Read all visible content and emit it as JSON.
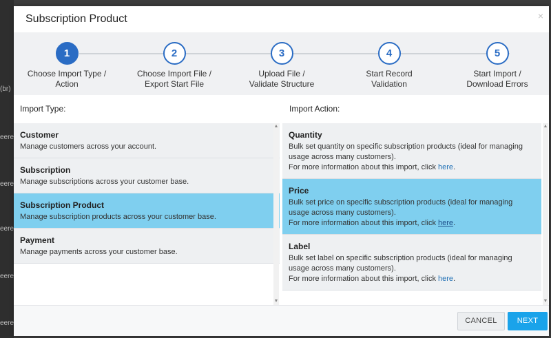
{
  "background": {
    "fragments": [
      "(br)",
      "eere",
      "eere",
      "eere",
      "eere",
      "eere",
      "eere"
    ]
  },
  "modal": {
    "title": "Subscription Product",
    "close_icon": "×"
  },
  "wizard": {
    "steps": [
      {
        "number": "1",
        "line1": "Choose Import Type /",
        "line2": "Action",
        "active": true
      },
      {
        "number": "2",
        "line1": "Choose Import File /",
        "line2": "Export Start File",
        "active": false
      },
      {
        "number": "3",
        "line1": "Upload File /",
        "line2": "Validate Structure",
        "active": false
      },
      {
        "number": "4",
        "line1": "Start Record",
        "line2": "Validation",
        "active": false
      },
      {
        "number": "5",
        "line1": "Start Import /",
        "line2": "Download Errors",
        "active": false
      }
    ]
  },
  "import_type": {
    "heading": "Import Type:",
    "items": [
      {
        "title": "Customer",
        "desc": "Manage customers across your account."
      },
      {
        "title": "Subscription",
        "desc": "Manage subscriptions across your customer base."
      },
      {
        "title": "Subscription Product",
        "desc": "Manage subscription products across your customer base.",
        "selected": true
      },
      {
        "title": "Payment",
        "desc": "Manage payments across your customer base."
      }
    ]
  },
  "import_action": {
    "heading": "Import Action:",
    "items": [
      {
        "title": "Quantity",
        "desc": "Bulk set quantity on specific subscription products (ideal for managing usage across many customers).",
        "more": "For more information about this import, click ",
        "link": "here",
        "tail": "."
      },
      {
        "title": "Price",
        "desc": "Bulk set price on specific subscription products (ideal for managing usage across many customers).",
        "more": "For more information about this import, click ",
        "link": "here",
        "tail": ".",
        "selected": true
      },
      {
        "title": "Label",
        "desc": "Bulk set label on specific subscription products (ideal for managing usage across many customers).",
        "more": "For more information about this import, click ",
        "link": "here",
        "tail": "."
      }
    ]
  },
  "footer": {
    "cancel_label": "CANCEL",
    "next_label": "NEXT"
  },
  "colors": {
    "accent": "#2a6cc4",
    "selected_row": "#7fcfef",
    "next_button": "#1aa3ea"
  }
}
